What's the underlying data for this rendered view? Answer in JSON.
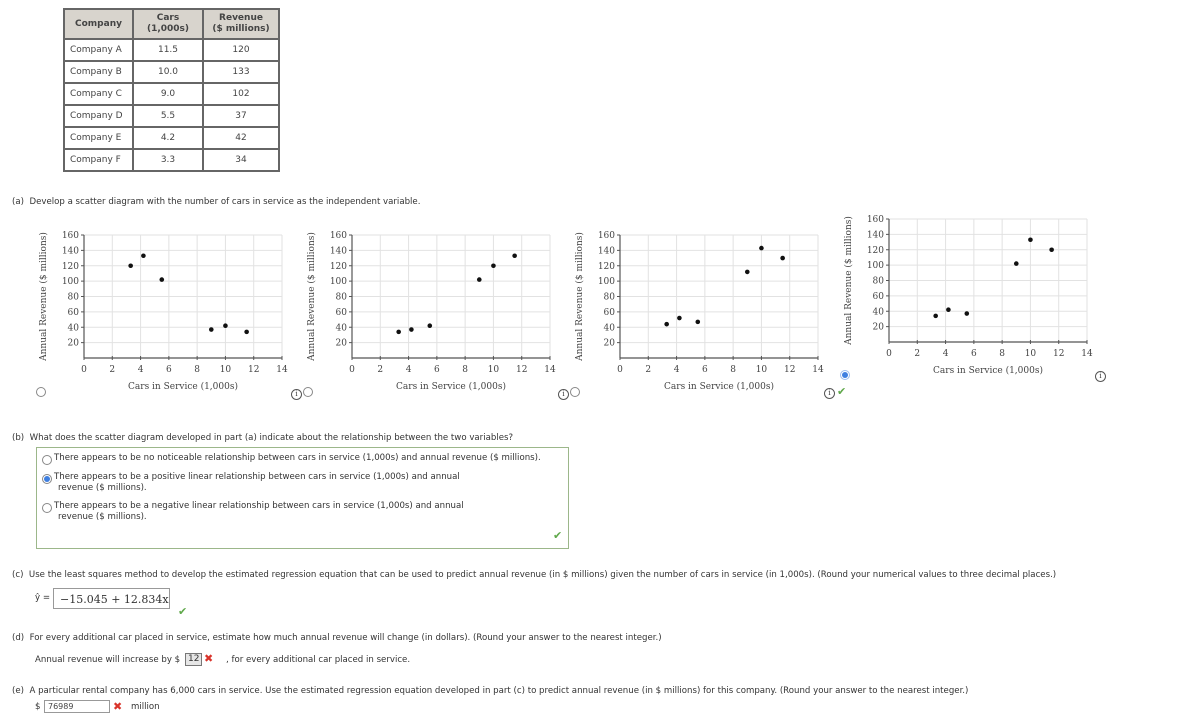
{
  "table": {
    "headers": [
      "Company",
      "Cars\n(1,000s)",
      "Revenue\n($ millions)"
    ],
    "header_lines": [
      [
        "Company"
      ],
      [
        "Cars",
        "(1,000s)"
      ],
      [
        "Revenue",
        "($ millions)"
      ]
    ],
    "rows": [
      [
        "Company A",
        "11.5",
        "120"
      ],
      [
        "Company B",
        "10.0",
        "133"
      ],
      [
        "Company C",
        "9.0",
        "102"
      ],
      [
        "Company D",
        "5.5",
        "37"
      ],
      [
        "Company E",
        "4.2",
        "42"
      ],
      [
        "Company F",
        "3.3",
        "34"
      ]
    ]
  },
  "part_a": {
    "label": "(a)",
    "prompt": "Develop a scatter diagram with the number of cars in service as the independent variable.",
    "options": [
      {
        "selected": false,
        "status": "none"
      },
      {
        "selected": false,
        "status": "none"
      },
      {
        "selected": false,
        "status": "none"
      },
      {
        "selected": true,
        "status": "correct"
      }
    ]
  },
  "chart_data": [
    {
      "type": "scatter",
      "title": "",
      "xlabel": "Cars in Service (1,000s)",
      "ylabel": "Annual Revenue ($ millions)",
      "xlim": [
        0,
        14
      ],
      "ylim": [
        0,
        160
      ],
      "xticks": [
        0,
        2,
        4,
        6,
        8,
        10,
        12,
        14
      ],
      "yticks": [
        20,
        40,
        60,
        80,
        100,
        120,
        140,
        160
      ],
      "grid": true,
      "points": [
        [
          3.3,
          120
        ],
        [
          4.2,
          133
        ],
        [
          5.5,
          102
        ],
        [
          9.0,
          37
        ],
        [
          10.0,
          42
        ],
        [
          11.5,
          34
        ]
      ]
    },
    {
      "type": "scatter",
      "title": "",
      "xlabel": "Cars in Service (1,000s)",
      "ylabel": "Annual Revenue ($ millions)",
      "xlim": [
        0,
        14
      ],
      "ylim": [
        0,
        160
      ],
      "xticks": [
        0,
        2,
        4,
        6,
        8,
        10,
        12,
        14
      ],
      "yticks": [
        20,
        40,
        60,
        80,
        100,
        120,
        140,
        160
      ],
      "grid": true,
      "points": [
        [
          3.3,
          34
        ],
        [
          4.2,
          37
        ],
        [
          5.5,
          42
        ],
        [
          9.0,
          102
        ],
        [
          10.0,
          120
        ],
        [
          11.5,
          133
        ]
      ]
    },
    {
      "type": "scatter",
      "title": "",
      "xlabel": "Cars in Service (1,000s)",
      "ylabel": "Annual Revenue ($ millions)",
      "xlim": [
        0,
        14
      ],
      "ylim": [
        0,
        160
      ],
      "xticks": [
        0,
        2,
        4,
        6,
        8,
        10,
        12,
        14
      ],
      "yticks": [
        20,
        40,
        60,
        80,
        100,
        120,
        140,
        160
      ],
      "grid": true,
      "points": [
        [
          3.3,
          44
        ],
        [
          4.2,
          52
        ],
        [
          5.5,
          47
        ],
        [
          9.0,
          112
        ],
        [
          10.0,
          143
        ],
        [
          11.5,
          130
        ]
      ]
    },
    {
      "type": "scatter",
      "title": "",
      "xlabel": "Cars in Service (1,000s)",
      "ylabel": "Annual Revenue ($ millions)",
      "xlim": [
        0,
        14
      ],
      "ylim": [
        0,
        160
      ],
      "xticks": [
        0,
        2,
        4,
        6,
        8,
        10,
        12,
        14
      ],
      "yticks": [
        20,
        40,
        60,
        80,
        100,
        120,
        140,
        160
      ],
      "grid": true,
      "points": [
        [
          3.3,
          34
        ],
        [
          4.2,
          42
        ],
        [
          5.5,
          37
        ],
        [
          9.0,
          102
        ],
        [
          10.0,
          133
        ],
        [
          11.5,
          120
        ]
      ]
    }
  ],
  "part_b": {
    "label": "(b)",
    "prompt": "What does the scatter diagram developed in part (a) indicate about the relationship between the two variables?",
    "options": [
      {
        "text": "There appears to be no noticeable relationship between cars in service (1,000s) and annual revenue ($ millions).",
        "selected": false
      },
      {
        "text": "There appears to be a positive linear relationship between cars in service (1,000s) and annual revenue ($ millions).",
        "line1": "There appears to be a positive linear relationship between cars in service (1,000s) and annual",
        "line2": "revenue ($ millions).",
        "selected": true
      },
      {
        "text": "There appears to be a negative linear relationship between cars in service (1,000s) and annual revenue ($ millions).",
        "line1": "There appears to be a negative linear relationship between cars in service (1,000s) and annual",
        "line2": "revenue ($ millions).",
        "selected": false
      }
    ],
    "status": "correct"
  },
  "part_c": {
    "label": "(c)",
    "prompt": "Use the least squares method to develop the estimated regression equation that can be used to predict annual revenue (in $ millions) given the number of cars in service (in 1,000s). (Round your numerical values to three decimal places.)",
    "yhat_label": "ŷ =",
    "answer": "−15.045 + 12.834x",
    "status": "correct"
  },
  "part_d": {
    "label": "(d)",
    "prompt": "For every additional car placed in service, estimate how much annual revenue will change (in dollars). (Round your answer to the nearest integer.)",
    "prefix": "Annual revenue will increase by $",
    "answer": "12",
    "suffix": ", for every additional car placed in service.",
    "status": "incorrect"
  },
  "part_e": {
    "label": "(e)",
    "prompt": "A particular rental company has 6,000 cars in service. Use the estimated regression equation developed in part (c) to predict annual revenue (in $ millions) for this company. (Round your answer to the nearest integer.)",
    "prefix": "$",
    "answer": "76989",
    "suffix": "million",
    "status": "incorrect"
  },
  "icons": {
    "info": "i",
    "check": "✔",
    "cross": "✖"
  }
}
